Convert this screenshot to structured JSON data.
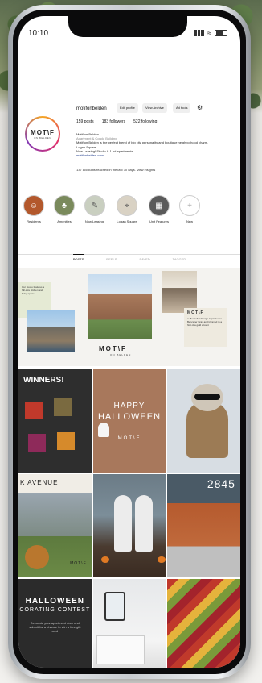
{
  "status": {
    "time": "10:10",
    "wifi_glyph": "≈"
  },
  "profile": {
    "username": "motifonbelden",
    "buttons": [
      "Edit profile",
      "View Archive",
      "Ad tools"
    ],
    "avatar_line1": "MOT\\F",
    "avatar_line2": "ON BELDEN",
    "stats": {
      "posts": "159 posts",
      "followers": "183 followers",
      "following": "522 following"
    },
    "bio": {
      "name": "Motif on Belden",
      "category": "Apartment & Condo Building",
      "line1": "Motif on Belden is the perfect blend of big city personality and boutique neighborhood charm.",
      "line2": "Logan Square.",
      "line3": "Now Leasing! Studio & 1 bd apartments",
      "link": "motifonbelden.com"
    },
    "reached": "137 accounts reached in the last 30 days. View insights"
  },
  "highlights": [
    {
      "label": "Residents",
      "color": "#b3582c",
      "glyph": "☺"
    },
    {
      "label": "Amenities",
      "color": "#7a8a5c",
      "glyph": "♣"
    },
    {
      "label": "Now Leasing!",
      "color": "#c9cfc0",
      "glyph": "✎"
    },
    {
      "label": "Logan Square",
      "color": "#d9d2c4",
      "glyph": "⌖"
    },
    {
      "label": "Unit Features",
      "color": "#5a5a5a",
      "glyph": "▦"
    },
    {
      "label": "New",
      "color": "#ffffff",
      "glyph": "+"
    }
  ],
  "tabs": [
    "POSTS",
    "REELS",
    "SAVED",
    "TAGGED"
  ],
  "feature": {
    "card1_text": "Our studio features a full-size kitchen and living space",
    "logo": "MOT\\F",
    "logo_sub": "ON BELDEN",
    "card2_title": "MOT\\F",
    "card2_text": "a: Bencalier Design is painted in Bencalier Gray and trimmed in a hint of a gold accent"
  },
  "posts": {
    "winners": "WINNERS!",
    "happy": "HAPPY",
    "halloween": "HALLOWEEN",
    "motif": "MOT\\F",
    "avenue": "K AVENUE",
    "house_number": "2845",
    "decor1": "HALLOWEEN",
    "decor2": "CORATING CONTEST",
    "decor3": "Decorate your apartment door and submit for a chance to win a free gift card"
  }
}
